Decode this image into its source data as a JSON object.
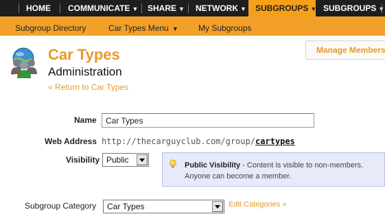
{
  "top_nav": {
    "items": [
      {
        "label": "HOME",
        "has_caret": false
      },
      {
        "label": "COMMUNICATE",
        "has_caret": true
      },
      {
        "label": "SHARE",
        "has_caret": true
      },
      {
        "label": "NETWORK",
        "has_caret": true
      },
      {
        "label": "SUBGROUPS",
        "has_caret": true,
        "active": true
      },
      {
        "label": "SUBGROUPS",
        "has_caret": true
      }
    ],
    "caret": "▼"
  },
  "sub_nav": {
    "directory": "Subgroup Directory",
    "car_types_menu": "Car Types Menu",
    "my_subgroups": "My Subgroups",
    "caret": "▼"
  },
  "header": {
    "icon": "group-members-icon",
    "title": "Car Types",
    "subtitle": "Administration",
    "back_link": "« Return to Car Types",
    "manage_members": "Manage Members"
  },
  "form": {
    "name_label": "Name",
    "name_value": "Car Types",
    "web_address_label": "Web Address",
    "web_address_base": "http://thecarguyclub.com/group/",
    "web_address_slug": "cartypes",
    "visibility_label": "Visibility",
    "visibility_value": "Public",
    "visibility_info": {
      "icon": "lightbulb-icon",
      "title": "Public Visibility",
      "text": " - Content is visible to non-members. Anyone can become a member."
    },
    "category_label": "Subgroup Category",
    "category_value": "Car Types",
    "edit_categories": "Edit Categories »"
  },
  "colors": {
    "nav_bg": "#1e1e1e",
    "accent": "#f2a02a",
    "link": "#e79a2b",
    "info_bg": "#e6eaf9"
  }
}
